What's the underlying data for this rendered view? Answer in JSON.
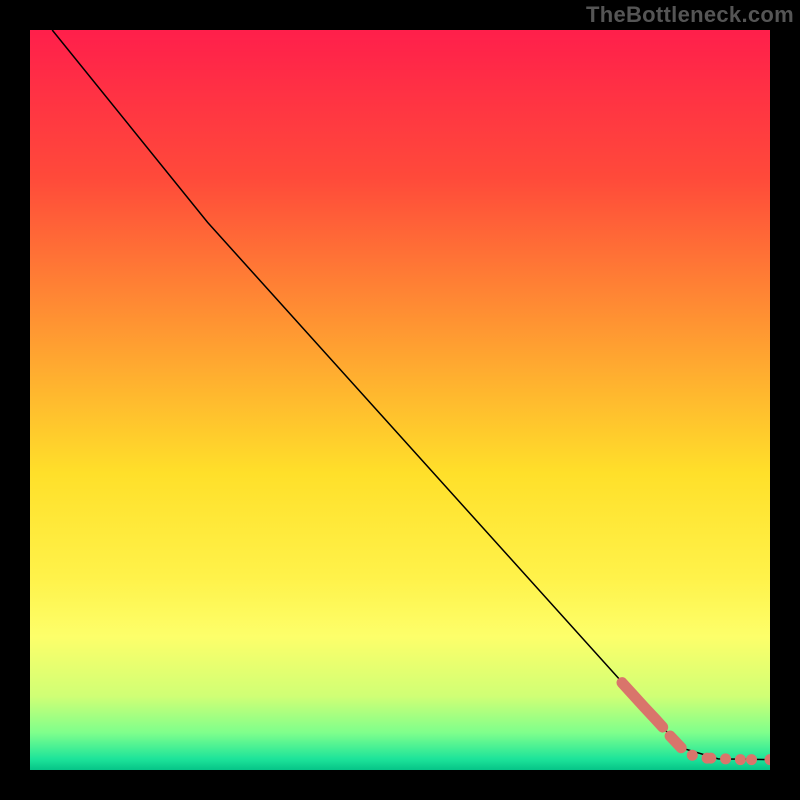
{
  "watermark": "TheBottleneck.com",
  "chart_data": {
    "type": "line",
    "title": "",
    "xlabel": "",
    "ylabel": "",
    "xlim": [
      0,
      100
    ],
    "ylim": [
      0,
      100
    ],
    "gradient_stops": [
      {
        "offset": 0.0,
        "color": "#ff1f4b"
      },
      {
        "offset": 0.2,
        "color": "#ff4a3a"
      },
      {
        "offset": 0.45,
        "color": "#ffa830"
      },
      {
        "offset": 0.6,
        "color": "#ffe02a"
      },
      {
        "offset": 0.74,
        "color": "#fff24a"
      },
      {
        "offset": 0.82,
        "color": "#fdff6a"
      },
      {
        "offset": 0.9,
        "color": "#d0ff75"
      },
      {
        "offset": 0.95,
        "color": "#7eff8c"
      },
      {
        "offset": 0.985,
        "color": "#1de49a"
      },
      {
        "offset": 1.0,
        "color": "#06c487"
      }
    ],
    "series": [
      {
        "name": "curve",
        "style": "line-thin-black",
        "points": [
          {
            "x": 3.0,
            "y": 100.0
          },
          {
            "x": 24.0,
            "y": 74.0
          },
          {
            "x": 88.0,
            "y": 3.0
          },
          {
            "x": 93.0,
            "y": 1.5
          },
          {
            "x": 100.0,
            "y": 1.4
          }
        ]
      },
      {
        "name": "highlight-segment-1",
        "style": "thick-salmon",
        "points": [
          {
            "x": 80.0,
            "y": 11.8
          },
          {
            "x": 82.0,
            "y": 9.6
          },
          {
            "x": 83.0,
            "y": 8.5
          },
          {
            "x": 84.5,
            "y": 6.9
          },
          {
            "x": 85.5,
            "y": 5.8
          }
        ]
      },
      {
        "name": "highlight-segment-2",
        "style": "thick-salmon",
        "points": [
          {
            "x": 86.5,
            "y": 4.6
          },
          {
            "x": 88.0,
            "y": 3.0
          }
        ]
      },
      {
        "name": "highlight-dots",
        "style": "dot-salmon",
        "points": [
          {
            "x": 89.5,
            "y": 2.0
          },
          {
            "x": 91.5,
            "y": 1.6
          },
          {
            "x": 92.0,
            "y": 1.6
          },
          {
            "x": 94.0,
            "y": 1.5
          },
          {
            "x": 96.0,
            "y": 1.4
          },
          {
            "x": 97.5,
            "y": 1.4
          },
          {
            "x": 100.0,
            "y": 1.4
          }
        ]
      }
    ]
  }
}
